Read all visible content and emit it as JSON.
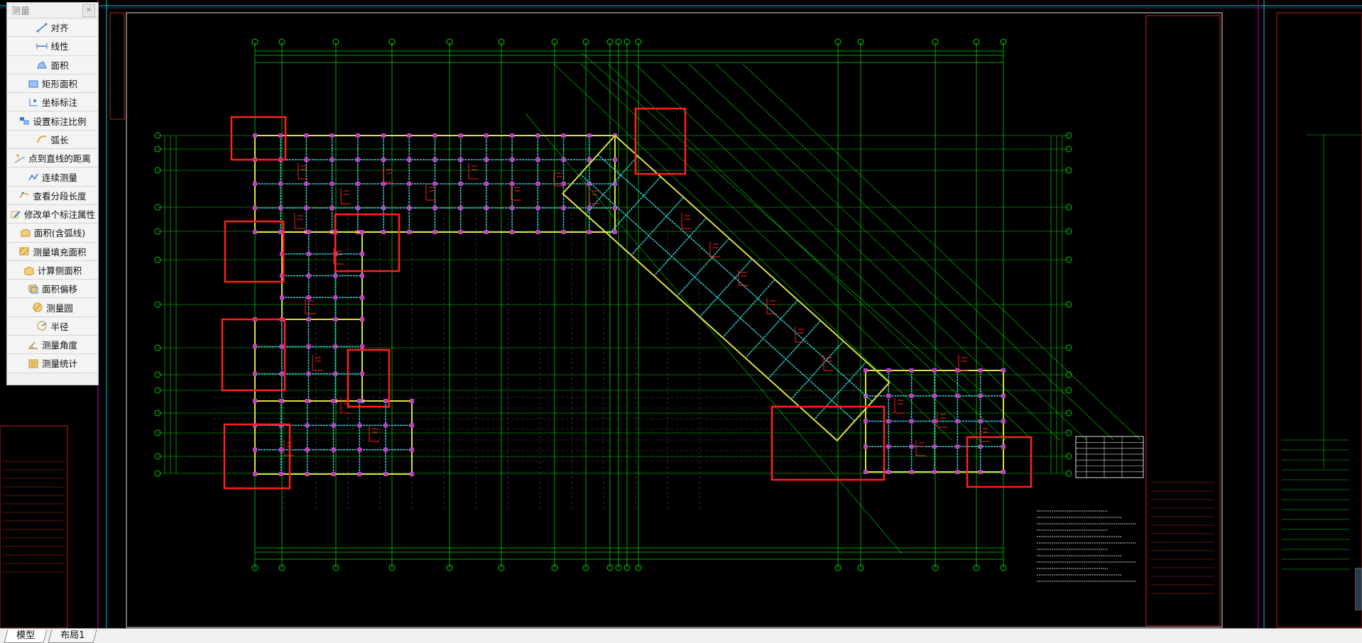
{
  "panel": {
    "title": "测量",
    "close_symbol": "×"
  },
  "tools": [
    {
      "label": "对齐",
      "icon": "align-measure-icon"
    },
    {
      "label": "线性",
      "icon": "linear-measure-icon"
    },
    {
      "label": "面积",
      "icon": "area-measure-icon"
    },
    {
      "label": "矩形面积",
      "icon": "rect-area-icon"
    },
    {
      "label": "坐标标注",
      "icon": "coordinate-icon"
    },
    {
      "label": "设置标注比例",
      "icon": "scale-setting-icon"
    },
    {
      "label": "弧长",
      "icon": "arc-length-icon"
    },
    {
      "label": "点到直线的距离",
      "icon": "point-line-distance-icon"
    },
    {
      "label": "连续测量",
      "icon": "continuous-measure-icon"
    },
    {
      "label": "查看分段长度",
      "icon": "segment-length-icon"
    },
    {
      "label": "修改单个标注属性",
      "icon": "edit-annotation-icon"
    },
    {
      "label": "面积(含弧线)",
      "icon": "arc-area-icon"
    },
    {
      "label": "测量填充面积",
      "icon": "hatch-area-icon"
    },
    {
      "label": "计算侧面积",
      "icon": "side-area-icon"
    },
    {
      "label": "面积偏移",
      "icon": "area-offset-icon"
    },
    {
      "label": "测量圆",
      "icon": "circle-measure-icon"
    },
    {
      "label": "半径",
      "icon": "radius-icon"
    },
    {
      "label": "测量角度",
      "icon": "angle-measure-icon"
    },
    {
      "label": "测量统计",
      "icon": "measure-stats-icon"
    }
  ],
  "tabs": [
    {
      "label": "模型",
      "active": true
    },
    {
      "label": "布局1",
      "active": false
    }
  ],
  "colors": {
    "background": "#000000",
    "grid_green": "#00d000",
    "beam_cyan": "#2fd0d0",
    "wall_yellow": "#e0e040",
    "column_magenta": "#c040c0",
    "markup_red": "#ff2020",
    "frame_cyan": "#00c8c8",
    "frame_magenta": "#c000c0"
  }
}
